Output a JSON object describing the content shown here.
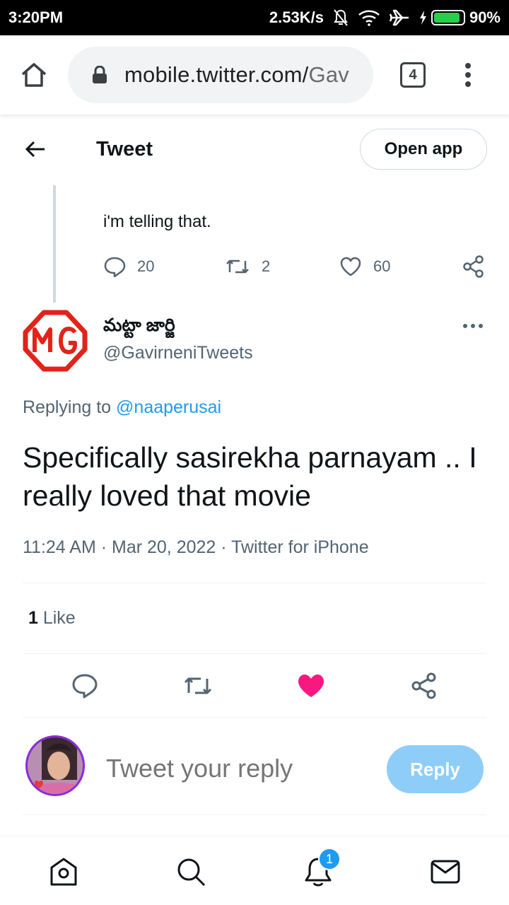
{
  "status_bar": {
    "time": "3:20PM",
    "network_speed": "2.53K/s",
    "battery": "90%",
    "battery_level": 0.9,
    "icons": [
      "mute-icon",
      "wifi-icon",
      "airplane-icon",
      "charging-icon",
      "battery-icon"
    ]
  },
  "browser": {
    "url_main": "mobile.twitter.com/",
    "url_dim": "Gav",
    "tab_count": "4"
  },
  "header": {
    "title": "Tweet",
    "open_app_label": "Open app"
  },
  "parent_tweet": {
    "text": "i'm telling that.",
    "replies": "20",
    "retweets": "2",
    "likes": "60"
  },
  "tweet": {
    "author_name": "మట్టా జార్జి",
    "author_handle": "@GavirneniTweets",
    "replying_prefix": "Replying to ",
    "replying_to": "@naaperusai",
    "text": "Specifically sasirekha parnayam .. I really loved that movie",
    "timestamp": "11:24 AM · Mar 20, 2022 · Twitter for iPhone",
    "like_count": "1",
    "like_label": " Like",
    "liked": true,
    "like_color": "#f91880"
  },
  "composer": {
    "placeholder": "Tweet your reply",
    "reply_label": "Reply",
    "reply_color": "#8ecdf8"
  },
  "bottom_nav": {
    "items": [
      "home-icon",
      "search-icon",
      "notifications-icon",
      "messages-icon"
    ],
    "notification_badge": "1"
  },
  "colors": {
    "accent": "#1d9bf0",
    "mg_red": "#e2231a"
  }
}
